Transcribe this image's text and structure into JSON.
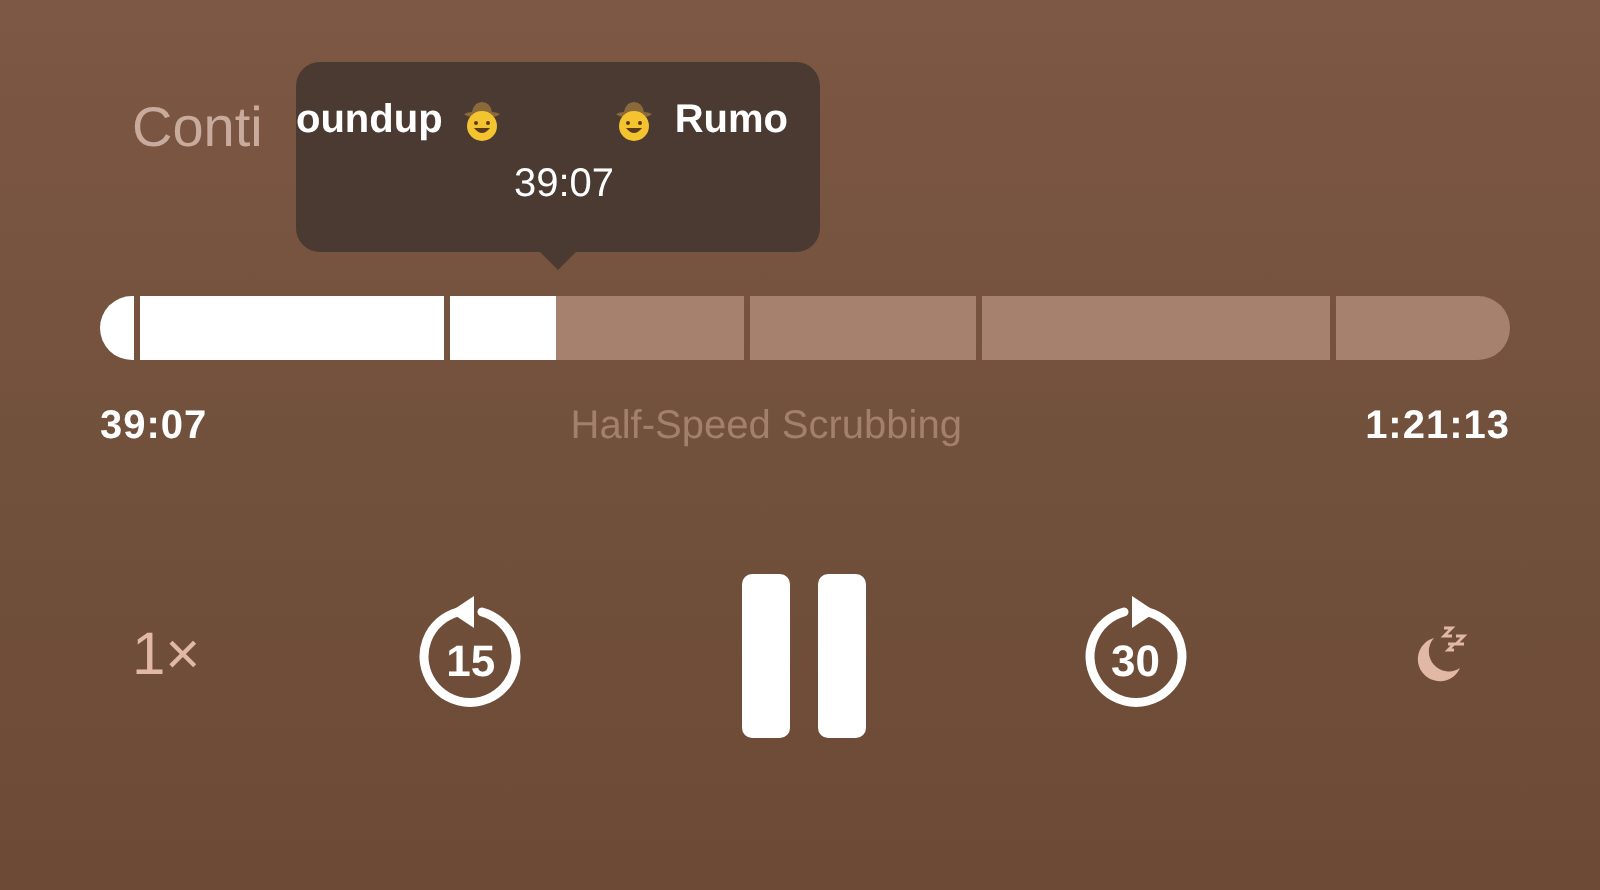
{
  "title": "Conti",
  "scrub_tooltip": {
    "left_text": "oundup",
    "right_text": "Rumo",
    "time": "39:07"
  },
  "progress": {
    "level": 0.323
  },
  "elapsed": "39:07",
  "mode_label": "Half-Speed Scrubbing",
  "remaining": "1:21:13",
  "controls": {
    "speed": "1×",
    "skip_back": "15",
    "playing": true,
    "skip_forward": "30"
  }
}
